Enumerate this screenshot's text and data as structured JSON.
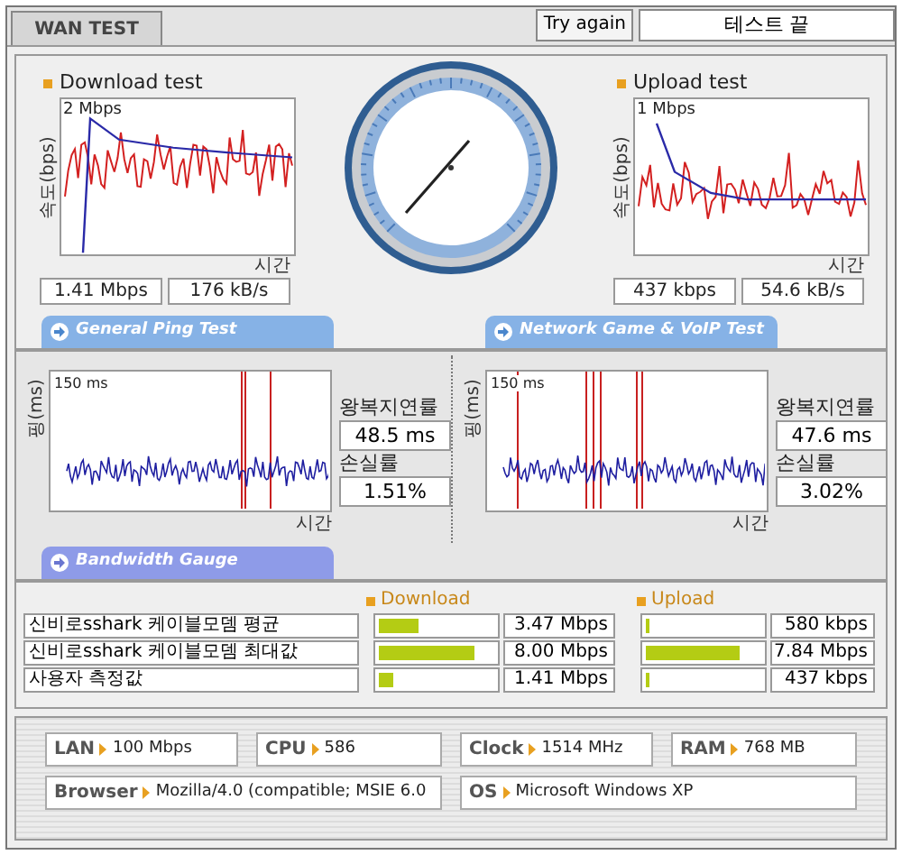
{
  "tab": {
    "label": "WAN TEST",
    "selected": true
  },
  "try_again_button": "Try again",
  "status_field": "테스트 끝",
  "speed_tests": [
    {
      "title": "Download test",
      "y_axis": "속도(bps)",
      "scale": "2 Mbps",
      "x_axis": "시간",
      "readings": [
        "1.41 Mbps",
        "176 kB/s"
      ]
    },
    {
      "title": "Upload test",
      "y_axis": "속도(bps)",
      "scale": "1 Mbps",
      "x_axis": "시간",
      "readings": [
        "437 kbps",
        "54.6 kB/s"
      ]
    }
  ],
  "section_tabs": [
    "General Ping Test",
    "Network Game & VoIP Test"
  ],
  "ping_tests": [
    {
      "y_axis": "핑(ms)",
      "scale": "150 ms",
      "x_axis": "시간",
      "latency_label": "왕복지연률",
      "latency": "48.5 ms",
      "loss_label": "손실률",
      "loss": "1.51%"
    },
    {
      "y_axis": "핑(ms)",
      "scale": "150 ms",
      "x_axis": "시간",
      "latency_label": "왕복지연률",
      "latency": "47.6 ms",
      "loss_label": "손실률",
      "loss": "3.02%"
    }
  ],
  "bandwidth": {
    "title": "Bandwidth Gauge",
    "download_label": "Download",
    "upload_label": "Upload",
    "rows": [
      {
        "name": "신비로sshark 케이블모뎀 평균",
        "download": {
          "level": 0.34,
          "reading": "3.47 Mbps"
        },
        "upload": {
          "level": 0.03,
          "reading": "580 kbps"
        }
      },
      {
        "name": "신비로sshark 케이블모뎀 최대값",
        "download": {
          "level": 0.83,
          "reading": "8.00 Mbps"
        },
        "upload": {
          "level": 0.81,
          "reading": "7.84 Mbps"
        }
      },
      {
        "name": "사용자 측정값",
        "download": {
          "level": 0.13,
          "reading": "1.41 Mbps"
        },
        "upload": {
          "level": 0.03,
          "reading": "437 kbps"
        }
      }
    ]
  },
  "system_info": [
    [
      {
        "label": "LAN",
        "value": "100 Mbps"
      },
      {
        "label": "CPU",
        "value": "586"
      },
      {
        "label": "Clock",
        "value": "1514 MHz"
      },
      {
        "label": "RAM",
        "value": "768 MB"
      }
    ],
    [
      {
        "label": "Browser",
        "value": "Mozilla/4.0 (compatible; MSIE 6.0"
      },
      {
        "label": "OS",
        "value": "Microsoft Windows XP"
      }
    ]
  ]
}
